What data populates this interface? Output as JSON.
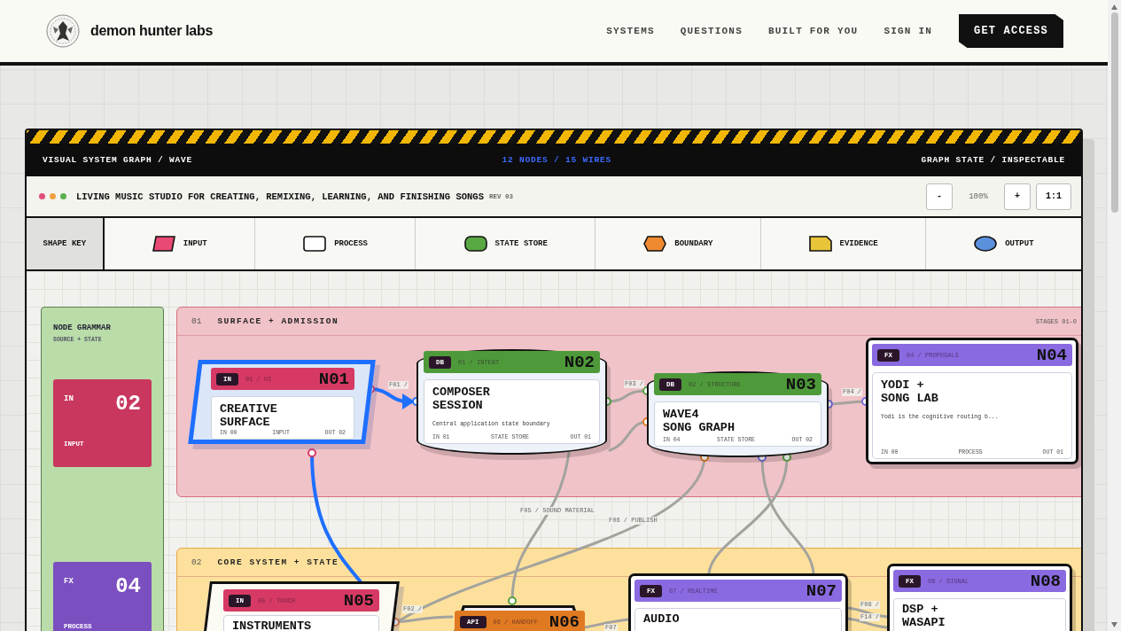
{
  "header": {
    "brand": "demon hunter labs",
    "nav": [
      {
        "label": "SYSTEMS"
      },
      {
        "label": "QUESTIONS"
      },
      {
        "label": "BUILT FOR YOU"
      },
      {
        "label": "SIGN IN"
      }
    ],
    "cta": "GET ACCESS"
  },
  "graph_bar": {
    "title": "VISUAL SYSTEM GRAPH / WAVE",
    "counts": "12 NODES / 15 WIRES",
    "state": "GRAPH STATE / INSPECTABLE"
  },
  "title_bar": {
    "dots": [
      {
        "color": "#e0507a"
      },
      {
        "color": "#f0a040"
      },
      {
        "color": "#5ab050"
      }
    ],
    "title": "LIVING MUSIC STUDIO FOR CREATING, REMIXING, LEARNING, AND FINISHING SONGS",
    "rev": "REV 03",
    "zoom_out": "-",
    "zoom": "100%",
    "zoom_in": "+",
    "reset": "1:1"
  },
  "shape_key": {
    "label": "SHAPE KEY",
    "items": [
      {
        "kind": "input",
        "label": "INPUT",
        "color": "#e84a74"
      },
      {
        "kind": "process",
        "label": "PROCESS",
        "color": "#ffffff"
      },
      {
        "kind": "store",
        "label": "STATE STORE",
        "color": "#5aa844"
      },
      {
        "kind": "boundary",
        "label": "BOUNDARY",
        "color": "#f08a30"
      },
      {
        "kind": "evidence",
        "label": "EVIDENCE",
        "color": "#e8c43a"
      },
      {
        "kind": "output",
        "label": "OUTPUT",
        "color": "#5a90dc"
      }
    ]
  },
  "sidebar": {
    "title": "NODE GRAMMAR",
    "subtitle": "SOURCE + STATE",
    "cards": [
      {
        "tag": "IN",
        "count": "02",
        "label": "INPUT",
        "color": "#c9375f"
      },
      {
        "tag": "FX",
        "count": "04",
        "label": "PROCESS",
        "color": "#7b4fc0"
      }
    ]
  },
  "stages": [
    {
      "number": "01",
      "title": "SURFACE + ADMISSION",
      "range": "STAGES 01-0",
      "color": "#f0c3c8"
    },
    {
      "number": "02",
      "title": "CORE SYSTEM + STATE",
      "color": "#fde09c"
    }
  ],
  "nodes": [
    {
      "id": "N01",
      "kind": "input",
      "tag": "IN",
      "meta": "01 / UI",
      "title": "CREATIVE\nSURFACE",
      "ports": [
        "IN 00",
        "INPUT",
        "OUT 02"
      ],
      "color": "#d63a64",
      "selected": true
    },
    {
      "id": "N02",
      "kind": "store",
      "tag": "DB",
      "meta": "01 / INTENT",
      "title": "COMPOSER\nSESSION",
      "description": "Central application state boundary",
      "ports": [
        "IN 01",
        "STATE STORE",
        "OUT 01"
      ],
      "color": "#4e9a3a",
      "selected": false
    },
    {
      "id": "N03",
      "kind": "store",
      "tag": "DB",
      "meta": "02 / STRUCTURE",
      "title": "WAVE4\nSONG GRAPH",
      "ports": [
        "IN 04",
        "STATE STORE",
        "OUT 02"
      ],
      "color": "#4e9a3a",
      "selected": false
    },
    {
      "id": "N04",
      "kind": "process",
      "tag": "FX",
      "meta": "04 / PROPOSALS",
      "title": "YODI +\nSONG LAB",
      "description": "Yodi is the cognitive routing b...",
      "ports": [
        "IN 00",
        "PROCESS",
        "OUT 01"
      ],
      "color": "#8a6ae0",
      "selected": false
    },
    {
      "id": "N05",
      "kind": "input",
      "tag": "IN",
      "meta": "05 / TOUCH",
      "title": "INSTRUMENTS",
      "color": "#d63a64",
      "selected": false
    },
    {
      "id": "N06",
      "kind": "boundary",
      "tag": "API",
      "meta": "06 / HANDOFF",
      "color": "#e07a22",
      "selected": false
    },
    {
      "id": "N07",
      "kind": "process",
      "tag": "FX",
      "meta": "07 / REALTIME",
      "title": "AUDIO",
      "color": "#8a6ae0",
      "selected": false
    },
    {
      "id": "N08",
      "kind": "process",
      "tag": "FX",
      "meta": "08 / SIGNAL",
      "title": "DSP +\nWASAPI",
      "color": "#8a6ae0",
      "selected": false
    }
  ],
  "wires": [
    {
      "label": "F01 /",
      "selected": true
    },
    {
      "selected": true
    },
    {
      "label": "F03 /",
      "selected": false
    },
    {
      "selected": false
    },
    {
      "label": "F04 /",
      "selected": false
    },
    {
      "label": "F05 / SOUND MATERIAL",
      "selected": false
    },
    {
      "label": "F06 / PUBLISH",
      "selected": false
    },
    {
      "selected": false
    },
    {
      "selected": false
    },
    {
      "label": "F02 /",
      "selected": false
    },
    {
      "label": "F07",
      "selected": false
    },
    {
      "label": "F08 /",
      "selected": false
    },
    {
      "label": "F14 /",
      "selected": false
    }
  ]
}
